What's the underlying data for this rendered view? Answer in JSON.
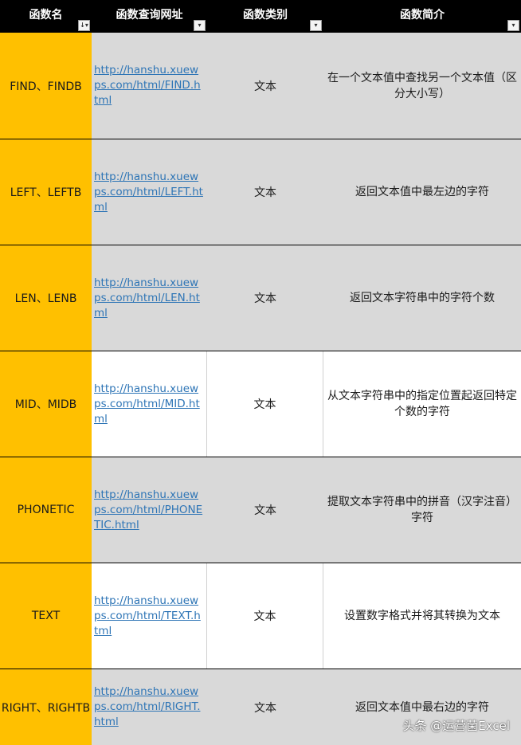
{
  "header": {
    "col1": "函数名",
    "col2": "函数查询网址",
    "col3": "函数类别",
    "col4": "函数简介",
    "filter_icon": "filter-dropdown-icon",
    "sort_icon": "sort-dropdown-icon",
    "active_filter_icon": "filter-active-icon"
  },
  "rows": [
    {
      "name": "FIND、FINDB",
      "url": "http://hanshu.xuewps.com/html/FIND.html",
      "category": "文本",
      "desc": "在一个文本值中查找另一个文本值（区分大小写）"
    },
    {
      "name": "LEFT、LEFTB",
      "url": "http://hanshu.xuewps.com/html/LEFT.html",
      "category": "文本",
      "desc": "返回文本值中最左边的字符"
    },
    {
      "name": "LEN、LENB",
      "url": "http://hanshu.xuewps.com/html/LEN.html",
      "category": "文本",
      "desc": "返回文本字符串中的字符个数"
    },
    {
      "name": "MID、MIDB",
      "url": "http://hanshu.xuewps.com/html/MID.html",
      "category": "文本",
      "desc": "从文本字符串中的指定位置起返回特定个数的字符"
    },
    {
      "name": "PHONETIC",
      "url": "http://hanshu.xuewps.com/html/PHONETIC.html",
      "category": "文本",
      "desc": "提取文本字符串中的拼音（汉字注音）字符"
    },
    {
      "name": "TEXT",
      "url": "http://hanshu.xuewps.com/html/TEXT.html",
      "category": "文本",
      "desc": "设置数字格式并将其转换为文本"
    },
    {
      "name": "RIGHT、RIGHTB",
      "url": "http://hanshu.xuewps.com/html/RIGHT.html",
      "category": "文本",
      "desc": "返回文本值中最右边的字符"
    }
  ],
  "watermark": "头条 @运营菌Excel",
  "colors": {
    "header_bg": "#000000",
    "name_col": "#ffc000",
    "row_gray": "#d9d9d9",
    "link": "#2e75b6"
  }
}
